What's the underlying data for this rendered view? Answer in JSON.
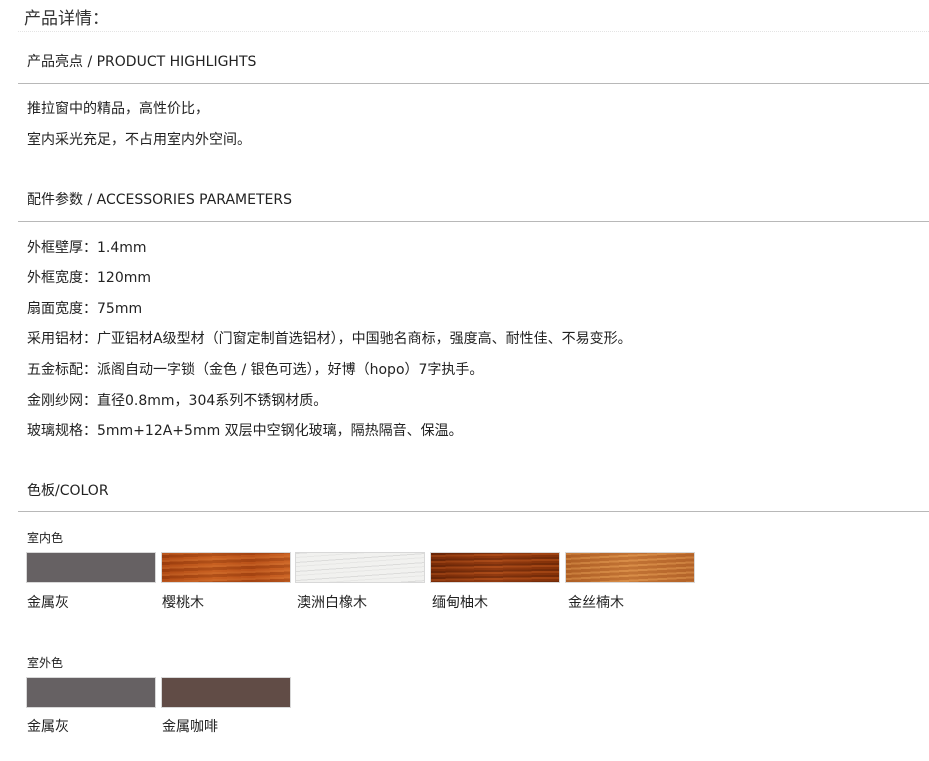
{
  "page_title": "产品详情：",
  "highlights": {
    "heading": "产品亮点 / PRODUCT HIGHLIGHTS",
    "lines": [
      "推拉窗中的精品，高性价比，",
      "室内采光充足，不占用室内外空间。"
    ]
  },
  "accessories": {
    "heading": "配件参数 / ACCESSORIES PARAMETERS",
    "lines": [
      "外框壁厚：1.4mm",
      "外框宽度：120mm",
      "扇面宽度：75mm",
      "采用铝材：广亚铝材A级型材（门窗定制首选铝材），中国驰名商标，强度高、耐性佳、不易变形。",
      "五金标配：派阁自动一字锁（金色 / 银色可选），好博（hopo）7字执手。",
      "金刚纱网：直径0.8mm，304系列不锈钢材质。",
      "玻璃规格：5mm+12A+5mm 双层中空钢化玻璃，隔热隔音、保温。"
    ]
  },
  "colors": {
    "heading": "色板/COLOR",
    "indoor": {
      "label": "室内色",
      "swatches": [
        {
          "name": "金属灰",
          "color": "#666163"
        },
        {
          "name": "樱桃木",
          "color": "#b94f17"
        },
        {
          "name": "澳洲白橡木",
          "color": "#f1f1ef"
        },
        {
          "name": "缅甸柚木",
          "color": "#8a3409"
        },
        {
          "name": "金丝楠木",
          "color": "#c47533"
        }
      ]
    },
    "outdoor": {
      "label": "室外色",
      "swatches": [
        {
          "name": "金属灰",
          "color": "#666163"
        },
        {
          "name": "金属咖啡",
          "color": "#614c46"
        }
      ]
    }
  }
}
